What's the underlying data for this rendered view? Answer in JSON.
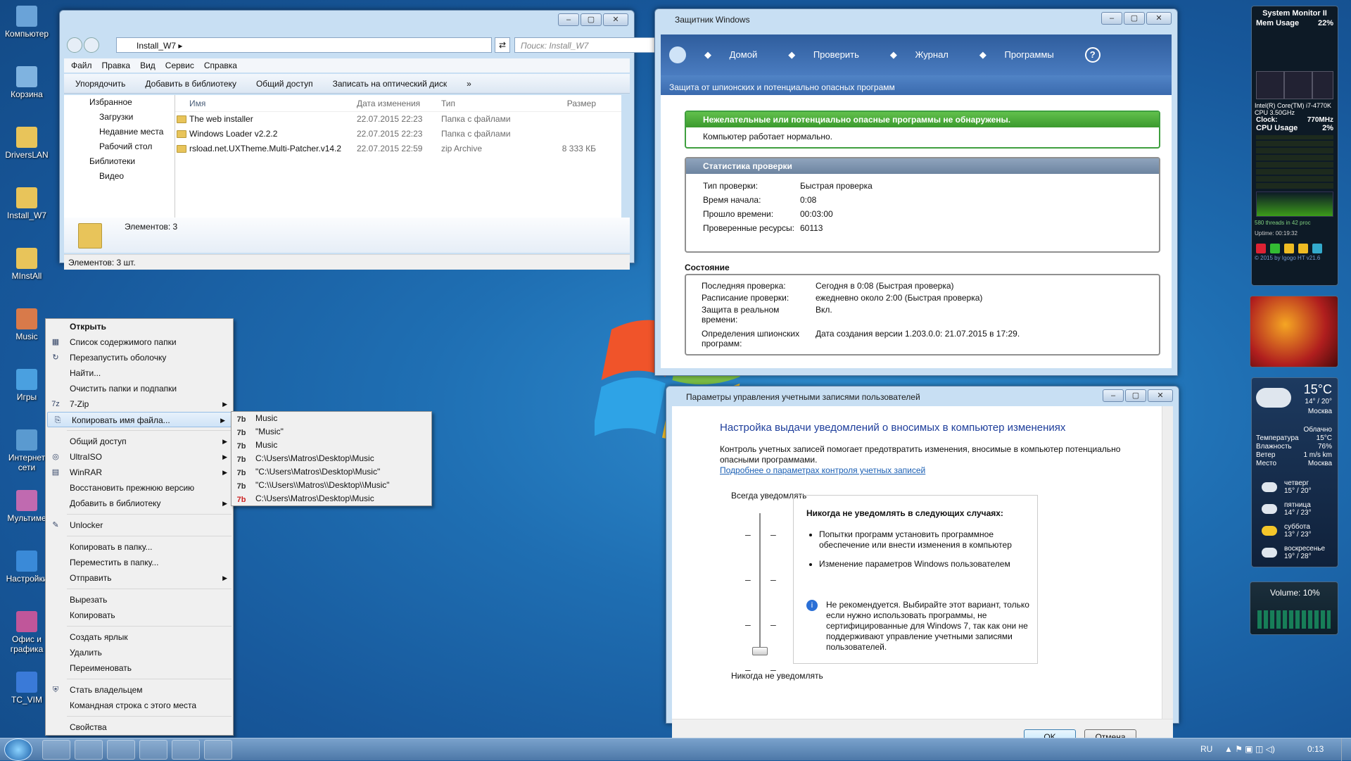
{
  "desktop": {
    "icons": [
      "Компьютер",
      "Корзина",
      "DriversLAN",
      "Install_W7",
      "MInstAll",
      "Music",
      "Игры",
      "Интернет сети",
      "Мультиме",
      "Настройки",
      "Офис и графика",
      "TC_VIM"
    ]
  },
  "explorer": {
    "path": "Install_W7",
    "search_placeholder": "Поиск: Install_W7",
    "menu": [
      "Файл",
      "Правка",
      "Вид",
      "Сервис",
      "Справка"
    ],
    "commands": [
      "Упорядочить",
      "Добавить в библиотеку",
      "Общий доступ",
      "Записать на оптический диск",
      "»"
    ],
    "nav": [
      "Избранное",
      "Загрузки",
      "Недавние места",
      "Рабочий стол",
      "Библиотеки",
      "Видео"
    ],
    "columns": [
      "Имя",
      "Дата изменения",
      "Тип",
      "Размер"
    ],
    "files": [
      {
        "name": "The web installer",
        "date": "22.07.2015 22:23",
        "type": "Папка с файлами",
        "size": ""
      },
      {
        "name": "Windows Loader v2.2.2",
        "date": "22.07.2015 22:23",
        "type": "Папка с файлами",
        "size": ""
      },
      {
        "name": "rsload.net.UXTheme.Multi-Patcher.v14.2",
        "date": "22.07.2015 22:59",
        "type": "zip Archive",
        "size": "8 333 КБ"
      }
    ],
    "details": "Элементов: 3",
    "status": "Элементов: 3 шт."
  },
  "defender": {
    "title": "Защитник Windows",
    "toolbar": [
      "Домой",
      "Проверить",
      "Журнал",
      "Программы"
    ],
    "subtitle": "Защита от шпионских  и потенциально опасных программ",
    "ok_banner": "Нежелательные или потенциально опасные программы не обнаружены.",
    "ok_text": "Компьютер работает нормально.",
    "stats_header": "Статистика проверки",
    "stats": [
      [
        "Тип проверки:",
        "Быстрая проверка"
      ],
      [
        "Время начала:",
        "0:08"
      ],
      [
        "Прошло времени:",
        "00:03:00"
      ],
      [
        "Проверенные ресурсы:",
        "60113"
      ]
    ],
    "state_header": "Состояние",
    "state": [
      [
        "Последняя проверка:",
        "Сегодня в 0:08 (Быстрая проверка)"
      ],
      [
        "Расписание проверки:",
        "ежедневно около 2:00  (Быстрая проверка)"
      ],
      [
        "Защита в реальном времени:",
        "Вкл."
      ],
      [
        "Определения шпионских программ:",
        "Дата создания версии 1.203.0.0: 21.07.2015 в 17:29."
      ]
    ]
  },
  "uac": {
    "title": "Параметры управления учетными записями пользователей",
    "heading": "Настройка выдачи уведомлений о вносимых в компьютер изменениях",
    "desc": "Контроль учетных записей помогает предотвратить изменения, вносимые в компьютер потенциально опасными программами.",
    "link": "Подробнее о параметрах контроля учетных записей",
    "always": "Всегда уведомлять",
    "never": "Никогда не уведомлять",
    "info_title": "Никогда не уведомлять в следующих случаях:",
    "bullets": [
      "Попытки программ установить программное обеспечение или внести изменения в компьютер",
      "Изменение параметров Windows пользователем"
    ],
    "warning": "Не рекомендуется. Выбирайте этот вариант, только если нужно использовать программы, не сертифицированные для Windows 7, так как они не поддерживают управление учетными записями пользователей.",
    "ok": "OK",
    "cancel": "Отмена"
  },
  "context": {
    "items": [
      {
        "label": "Открыть",
        "bold": true
      },
      {
        "label": "Список содержимого папки"
      },
      {
        "label": "Перезапустить оболочку"
      },
      {
        "label": "Найти..."
      },
      {
        "label": "Очистить папки и подпапки"
      },
      {
        "label": "7-Zip",
        "sub": true
      },
      {
        "label": "Копировать имя файла...",
        "sub": true,
        "selected": true
      },
      {
        "sep": true
      },
      {
        "label": "Общий доступ",
        "sub": true
      },
      {
        "label": "UltraISO",
        "sub": true
      },
      {
        "label": "WinRAR",
        "sub": true
      },
      {
        "label": "Восстановить прежнюю версию"
      },
      {
        "label": "Добавить в библиотеку",
        "sub": true
      },
      {
        "sep": true
      },
      {
        "label": "Unlocker"
      },
      {
        "sep": true
      },
      {
        "label": "Копировать в папку..."
      },
      {
        "label": "Переместить в папку..."
      },
      {
        "label": "Отправить",
        "sub": true
      },
      {
        "sep": true
      },
      {
        "label": "Вырезать"
      },
      {
        "label": "Копировать"
      },
      {
        "sep": true
      },
      {
        "label": "Создать ярлык"
      },
      {
        "label": "Удалить"
      },
      {
        "label": "Переименовать"
      },
      {
        "sep": true
      },
      {
        "label": "Стать владельцем"
      },
      {
        "label": "Командная строка с этого места"
      },
      {
        "sep": true
      },
      {
        "label": "Свойства"
      }
    ],
    "submenu": [
      "Music",
      "\"Music\"",
      "Music",
      "C:\\Users\\Matros\\Desktop\\Music",
      "\"C:\\Users\\Matros\\Desktop\\Music\"",
      "\"C:\\\\Users\\\\Matros\\\\Desktop\\\\Music\"",
      "C:\\Users\\Matros\\Desktop\\Music"
    ]
  },
  "sysmon": {
    "title": "System Monitor II",
    "mem_label": "Mem Usage",
    "mem": "22%",
    "cpu_name": "Intel(R) Core(TM) i7-4770K",
    "cpu_speed": "CPU 3.50GHz",
    "clock_label": "Clock:",
    "clock": "770MHz",
    "cpu_label": "CPU Usage",
    "cpu": "2%",
    "threads": "580 threads in 42 proc",
    "uptime": "Uptime: 00:19:32",
    "copyright": "© 2015 by Igogo HT v21.6"
  },
  "weather": {
    "temp": "15°C",
    "range": "14° / 20°",
    "city": "Москва",
    "cond": "Облачно",
    "rows": [
      [
        "Температура",
        "15°C"
      ],
      [
        "Влажность",
        "76%"
      ],
      [
        "Ветер",
        "1 m/s km"
      ],
      [
        "Место",
        "Москва"
      ]
    ],
    "forecast": [
      [
        "четверг",
        "15° / 20°"
      ],
      [
        "пятница",
        "14° / 23°"
      ],
      [
        "суббота",
        "13° / 23°"
      ],
      [
        "воскресенье",
        "19° / 28°"
      ]
    ]
  },
  "volume": {
    "label": "Volume: 10%"
  },
  "taskbar": {
    "lang": "RU",
    "time": "0:13"
  }
}
